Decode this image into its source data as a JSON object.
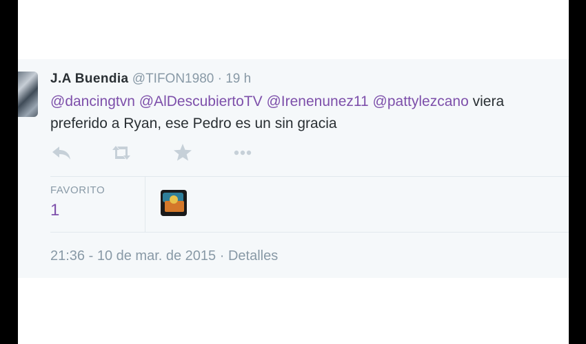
{
  "tweet": {
    "author_name": "J.A Buendia",
    "author_handle": "@TIFON1980",
    "separator": "·",
    "age": "19 h",
    "mentions": [
      "@dancingtvn",
      "@AlDescubiertoTV",
      "@Irenenunez11",
      "@pattylezcano"
    ],
    "text_line1_rest": "viera",
    "text_line2": "preferido a Ryan, ese Pedro es un sin gracia"
  },
  "actions": {
    "icons": [
      "reply-icon",
      "retweet-icon",
      "favorite-icon",
      "more-icon"
    ]
  },
  "stats": {
    "favorites_label": "FAVORITO",
    "favorites_count": "1"
  },
  "footer": {
    "timestamp": "21:36 - 10 de mar. de 2015",
    "separator": "·",
    "details_link": "Detalles"
  },
  "colors": {
    "mention": "#7d4faa",
    "muted": "#8899a6",
    "text": "#292f33",
    "card_background": "#f5f8fa"
  }
}
